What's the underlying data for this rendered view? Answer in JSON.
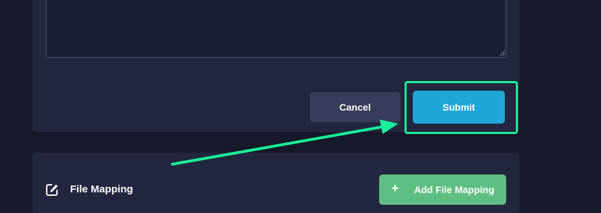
{
  "form": {
    "cancel_label": "Cancel",
    "submit_label": "Submit"
  },
  "file_mapping": {
    "title": "File Mapping",
    "icon": "edit-icon",
    "add_button_label": "Add File Mapping",
    "add_icon": "plus-icon"
  },
  "annotation": {
    "highlight_color": "#19f09a",
    "target": "submit-button"
  },
  "colors": {
    "background": "#16192a",
    "card": "#22273f",
    "submit": "#1fa6d8",
    "cancel": "#363c5a",
    "add": "#5fbf82"
  }
}
